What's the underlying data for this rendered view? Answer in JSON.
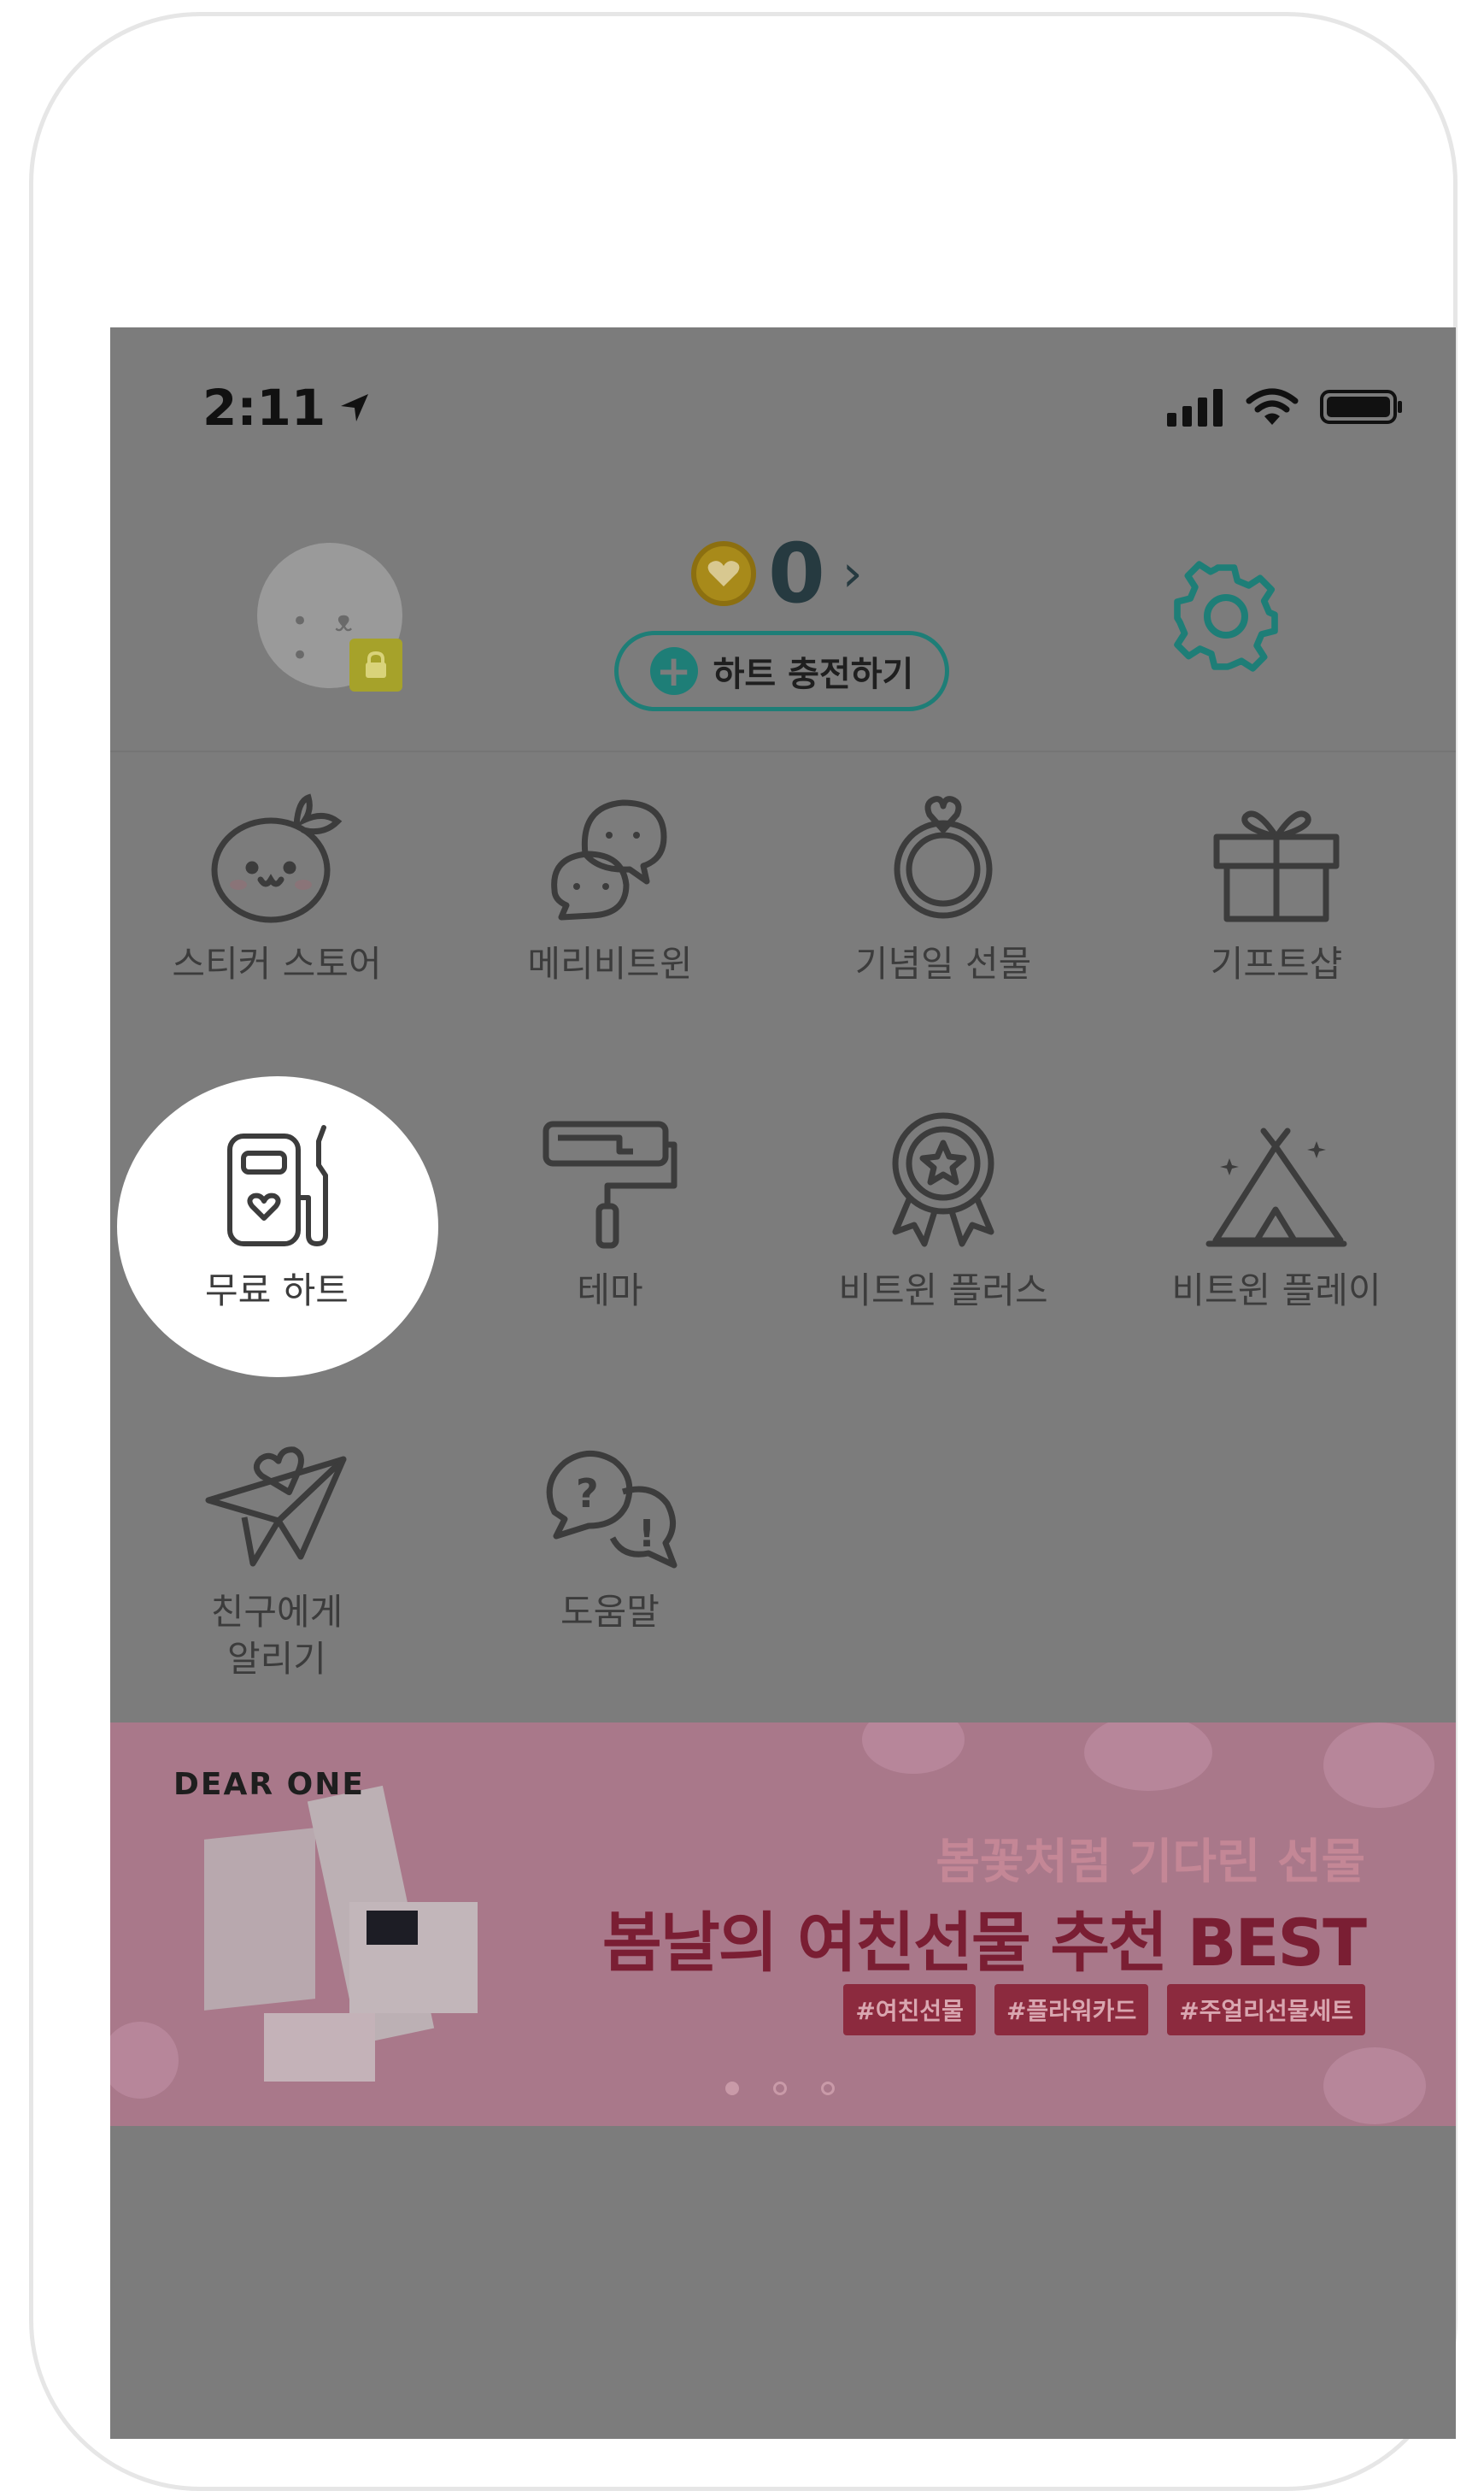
{
  "status_bar": {
    "time": "2:11"
  },
  "header": {
    "heart_count": "0",
    "charge_label": "하트 충전하기"
  },
  "menu": {
    "items": [
      {
        "label": "스티커 스토어",
        "icon": "sticker-face-icon"
      },
      {
        "label": "메리비트윈",
        "icon": "chat-bubbles-icon"
      },
      {
        "label": "기념일 선물",
        "icon": "ring-icon"
      },
      {
        "label": "기프트샵",
        "icon": "gift-icon"
      },
      {
        "label": "무료 하트",
        "icon": "fuel-heart-icon"
      },
      {
        "label": "테마",
        "icon": "paint-roller-icon"
      },
      {
        "label": "비트윈 플러스",
        "icon": "badge-star-icon"
      },
      {
        "label": "비트윈 플레이",
        "icon": "tent-icon"
      },
      {
        "label": "친구에게 알리기",
        "icon": "paper-plane-heart-icon"
      },
      {
        "label": "도움말",
        "icon": "help-bubbles-icon"
      }
    ]
  },
  "banner": {
    "brand": "DEAR ONE",
    "subtitle": "봄꽃처럼 기다린 선물",
    "title": "봄날의 여친선물 추천 BEST",
    "tags": [
      "#여친선물",
      "#플라워카드",
      "#주얼리선물세트"
    ],
    "page_total": 3,
    "page_current": 1
  },
  "colors": {
    "accent": "#1e7e77",
    "overlay": "#7c7c7c",
    "spotlight": "#ffffff"
  }
}
